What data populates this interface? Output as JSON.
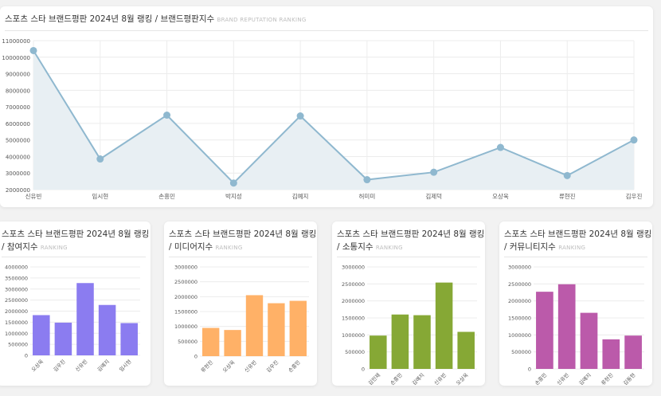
{
  "main": {
    "title": "스포츠 스타 브랜드평판 2024년 8월 랭킹 / 브랜드평판지수",
    "subtitle": "BRAND REPUTATION RANKING"
  },
  "cards": [
    {
      "title_line1": "스포츠 스타 브랜드평판 2024년 8월 랭킹",
      "title_line2": "/ 참여지수",
      "subtitle": "RANKING"
    },
    {
      "title_line1": "스포츠 스타 브랜드평판 2024년 8월 랭킹",
      "title_line2": "/ 미디어지수",
      "subtitle": "RANKING"
    },
    {
      "title_line1": "스포츠 스타 브랜드평판 2024년 8월 랭킹",
      "title_line2": "/ 소통지수",
      "subtitle": "RANKING"
    },
    {
      "title_line1": "스포츠 스타 브랜드평판 2024년 8월 랭킹",
      "title_line2": "/ 커뮤니티지수",
      "subtitle": "RANKING"
    }
  ],
  "colors": {
    "line": "#8fb8cf",
    "area": "#e8eff3",
    "bar1": "#8b7cf0",
    "bar2": "#ffb167",
    "bar3": "#86a835",
    "bar4": "#bb5aaa",
    "grid": "#ececec",
    "tick": "#555555"
  },
  "chart_data": [
    {
      "type": "area",
      "categories": [
        "신유빈",
        "임시현",
        "손흥민",
        "박지성",
        "김예지",
        "허미미",
        "김제덕",
        "오상욱",
        "류현진",
        "김우진"
      ],
      "values": [
        10400000,
        3850000,
        6500000,
        2400000,
        6450000,
        2600000,
        3050000,
        4550000,
        2850000,
        5000000
      ],
      "ylim": [
        2000000,
        11000000
      ],
      "yticks": [
        "2000000",
        "3000000",
        "4000000",
        "5000000",
        "6000000",
        "7000000",
        "8000000",
        "9000000",
        "10000000",
        "11000000"
      ],
      "grid": true
    },
    {
      "type": "bar",
      "categories": [
        "오상욱",
        "김우진",
        "신유빈",
        "김예지",
        "임시현"
      ],
      "values": [
        1820000,
        1480000,
        3270000,
        2280000,
        1460000
      ],
      "ylim": [
        0,
        4000000
      ],
      "yticks": [
        "0",
        "500000",
        "1000000",
        "1500000",
        "2000000",
        "2500000",
        "3000000",
        "3500000",
        "4000000"
      ],
      "grid": true
    },
    {
      "type": "bar",
      "categories": [
        "류현진",
        "오상욱",
        "신유빈",
        "김우진",
        "손흥민"
      ],
      "values": [
        950000,
        880000,
        2050000,
        1780000,
        1860000
      ],
      "ylim": [
        0,
        3000000
      ],
      "yticks": [
        "0",
        "500000",
        "1000000",
        "1500000",
        "2000000",
        "2500000",
        "3000000"
      ],
      "grid": true
    },
    {
      "type": "bar",
      "categories": [
        "김민재",
        "손흥민",
        "김예지",
        "신유빈",
        "오상욱"
      ],
      "values": [
        980000,
        1600000,
        1580000,
        2540000,
        1090000
      ],
      "ylim": [
        0,
        3000000
      ],
      "yticks": [
        "0",
        "500000",
        "1000000",
        "1500000",
        "2000000",
        "2500000",
        "3000000"
      ],
      "grid": true
    },
    {
      "type": "bar",
      "categories": [
        "손흥민",
        "신유빈",
        "김예지",
        "류현진",
        "김동현"
      ],
      "values": [
        2270000,
        2490000,
        1650000,
        870000,
        980000
      ],
      "ylim": [
        0,
        3000000
      ],
      "yticks": [
        "0",
        "500000",
        "1000000",
        "1500000",
        "2000000",
        "2500000",
        "3000000"
      ],
      "grid": true
    }
  ]
}
